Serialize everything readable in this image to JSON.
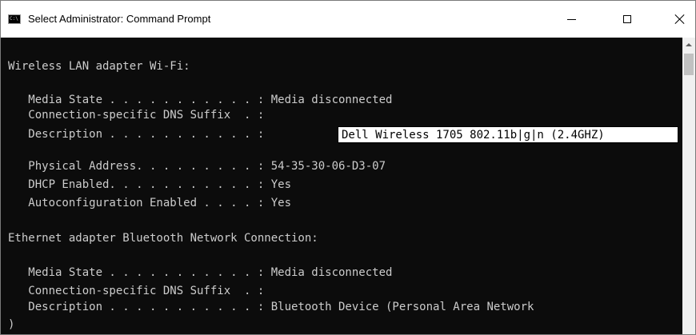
{
  "window": {
    "title": "Select Administrator: Command Prompt",
    "icon_label": "C:\\"
  },
  "console": {
    "lines": [
      "Wireless LAN adapter Wi-Fi:",
      "",
      "   Media State . . . . . . . . . . . : Media disconnected",
      "   Connection-specific DNS Suffix  . :",
      "   Description . . . . . . . . . . . :",
      "",
      "   Physical Address. . . . . . . . . : 54-35-30-06-D3-07",
      "   DHCP Enabled. . . . . . . . . . . : Yes",
      "   Autoconfiguration Enabled . . . . : Yes",
      "",
      "Ethernet adapter Bluetooth Network Connection:",
      "",
      "   Media State . . . . . . . . . . . : Media disconnected",
      "   Connection-specific DNS Suffix  . :",
      "   Description . . . . . . . . . . . : Bluetooth Device (Personal Area Network",
      ")"
    ],
    "selected_text": "Dell Wireless 1705 802.11b|g|n (2.4GHZ)"
  },
  "colors": {
    "console_bg": "#0c0c0c",
    "console_fg": "#cccccc",
    "selection_bg": "#ffffff",
    "selection_fg": "#000000"
  },
  "icons": [
    "cmd-app-icon",
    "minimize-icon",
    "maximize-icon",
    "close-icon",
    "scroll-up-icon"
  ]
}
